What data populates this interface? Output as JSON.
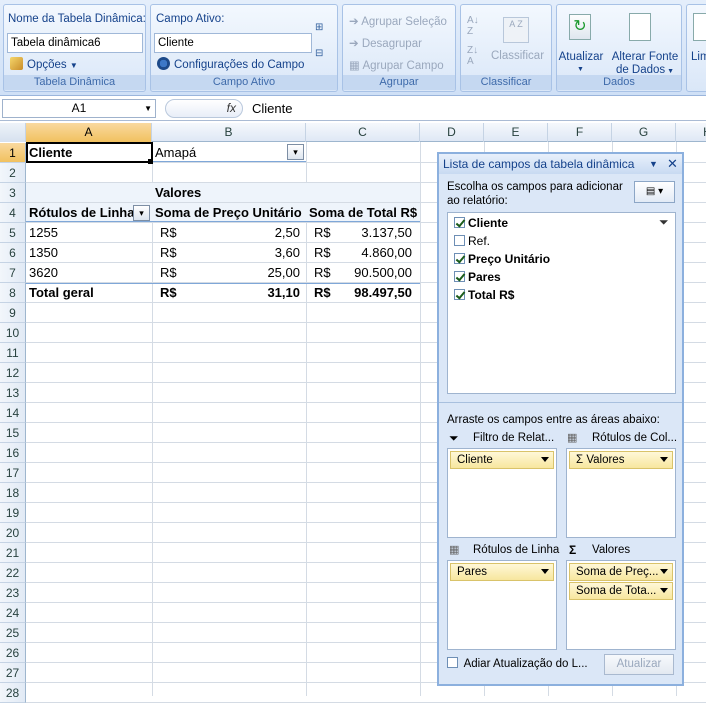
{
  "ribbon": {
    "pivot_group": {
      "name_label": "Nome da Tabela Dinâmica:",
      "name_value": "Tabela dinâmica6",
      "options_label": "Opções",
      "group_label": "Tabela Dinâmica"
    },
    "field_group": {
      "field_label": "Campo Ativo:",
      "field_value": "Cliente",
      "settings_label": "Configurações do Campo",
      "group_label": "Campo Ativo"
    },
    "group_group": {
      "group_selection": "Agrupar Seleção",
      "ungroup": "Desagrupar",
      "group_field": "Agrupar Campo",
      "group_label": "Agrupar"
    },
    "sort_group": {
      "sort": "Classificar",
      "group_label": "Classificar"
    },
    "data_group": {
      "refresh": "Atualizar",
      "change_source_1": "Alterar Fonte",
      "change_source_2": "de Dados",
      "group_label": "Dados"
    },
    "cut_label": "Lim"
  },
  "formula_bar": {
    "name_box": "A1",
    "fx": "fx",
    "value": "Cliente"
  },
  "columns": [
    "A",
    "B",
    "C",
    "D",
    "E",
    "F",
    "G",
    "H"
  ],
  "rows": [
    "1",
    "2",
    "3",
    "4",
    "5",
    "6",
    "7",
    "8",
    "9",
    "10",
    "11",
    "12",
    "13",
    "14",
    "15",
    "16",
    "17",
    "18",
    "19",
    "20",
    "21",
    "22",
    "23",
    "24",
    "25",
    "26",
    "27",
    "28"
  ],
  "sheet": {
    "a1": "Cliente",
    "b1": "Amapá",
    "b3": "Valores",
    "a4": "Rótulos de Linha",
    "b4": "Soma de Preço Unitário",
    "c4": "Soma de Total R$",
    "r5": {
      "a": "1255",
      "cur1": "R$",
      "b": "2,50",
      "cur2": "R$",
      "c": "3.137,50"
    },
    "r6": {
      "a": "1350",
      "cur1": "R$",
      "b": "3,60",
      "cur2": "R$",
      "c": "4.860,00"
    },
    "r7": {
      "a": "3620",
      "cur1": "R$",
      "b": "25,00",
      "cur2": "R$",
      "c": "90.500,00"
    },
    "r8": {
      "a": "Total geral",
      "cur1": "R$",
      "b": "31,10",
      "cur2": "R$",
      "c": "98.497,50"
    }
  },
  "panel": {
    "title": "Lista de campos da tabela dinâmica",
    "choose_1": "Escolha os campos para adicionar",
    "choose_2": "ao relatório:",
    "fields": [
      {
        "label": "Cliente",
        "checked": true
      },
      {
        "label": "Ref.",
        "checked": false
      },
      {
        "label": "Preço Unitário",
        "checked": true
      },
      {
        "label": "Pares",
        "checked": true
      },
      {
        "label": "Total R$",
        "checked": true
      }
    ],
    "drag_hint": "Arraste os campos entre as áreas abaixo:",
    "filter_label": "Filtro de Relat...",
    "col_label": "Rótulos de Col...",
    "row_label": "Rótulos de Linha",
    "values_label": "Valores",
    "filter_pill": "Cliente",
    "col_pill": "Valores",
    "row_pill": "Pares",
    "value_pill_1": "Soma de Preç...",
    "value_pill_2": "Soma de Tota...",
    "defer_label": "Adiar Atualização do L...",
    "update_button": "Atualizar"
  }
}
